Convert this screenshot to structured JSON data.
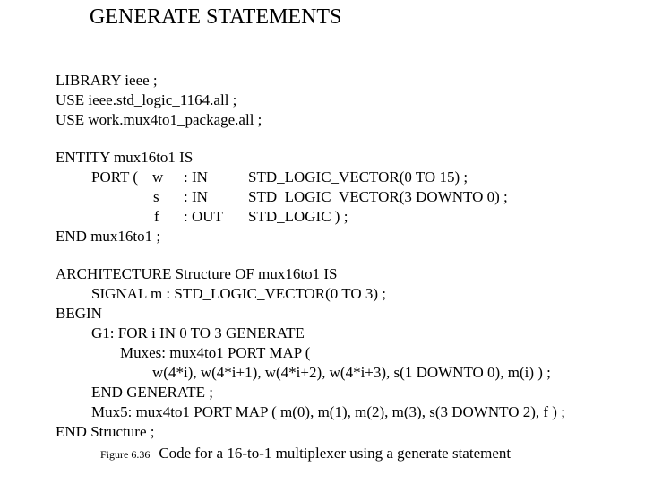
{
  "title": "GENERATE STATEMENTS",
  "libraries": [
    "LIBRARY ieee ;",
    "USE ieee.std_logic_1164.all ;",
    "USE work.mux4to1_package.all ;"
  ],
  "entity": {
    "header": "ENTITY mux16to1 IS",
    "port_keyword": "PORT (",
    "ports": [
      {
        "name": "w",
        "mode": ": IN",
        "type": "STD_LOGIC_VECTOR(0 TO 15) ;"
      },
      {
        "name": "s",
        "mode": ": IN",
        "type": "STD_LOGIC_VECTOR(3 DOWNTO 0) ;"
      },
      {
        "name": "f",
        "mode": ": OUT",
        "type": "STD_LOGIC ) ;"
      }
    ],
    "footer": "END mux16to1 ;"
  },
  "architecture": [
    {
      "indent": 0,
      "text": "ARCHITECTURE Structure OF mux16to1 IS"
    },
    {
      "indent": 1,
      "text": "SIGNAL m : STD_LOGIC_VECTOR(0 TO 3) ;"
    },
    {
      "indent": 0,
      "text": "BEGIN"
    },
    {
      "indent": 1,
      "text": "G1: FOR i IN 0 TO 3 GENERATE"
    },
    {
      "indent": 2,
      "text": "Muxes: mux4to1 PORT MAP ("
    },
    {
      "indent": 3,
      "text": "w(4*i), w(4*i+1), w(4*i+2), w(4*i+3), s(1 DOWNTO 0), m(i) ) ;"
    },
    {
      "indent": 1,
      "text": "END GENERATE ;"
    },
    {
      "indent": 1,
      "text": "Mux5: mux4to1 PORT MAP ( m(0), m(1), m(2), m(3), s(3 DOWNTO 2), f ) ;"
    },
    {
      "indent": 0,
      "text": "END Structure ;"
    }
  ],
  "caption": {
    "figure": "Figure 6.36",
    "text": "Code for a 16-to-1 multiplexer using a generate statement"
  }
}
